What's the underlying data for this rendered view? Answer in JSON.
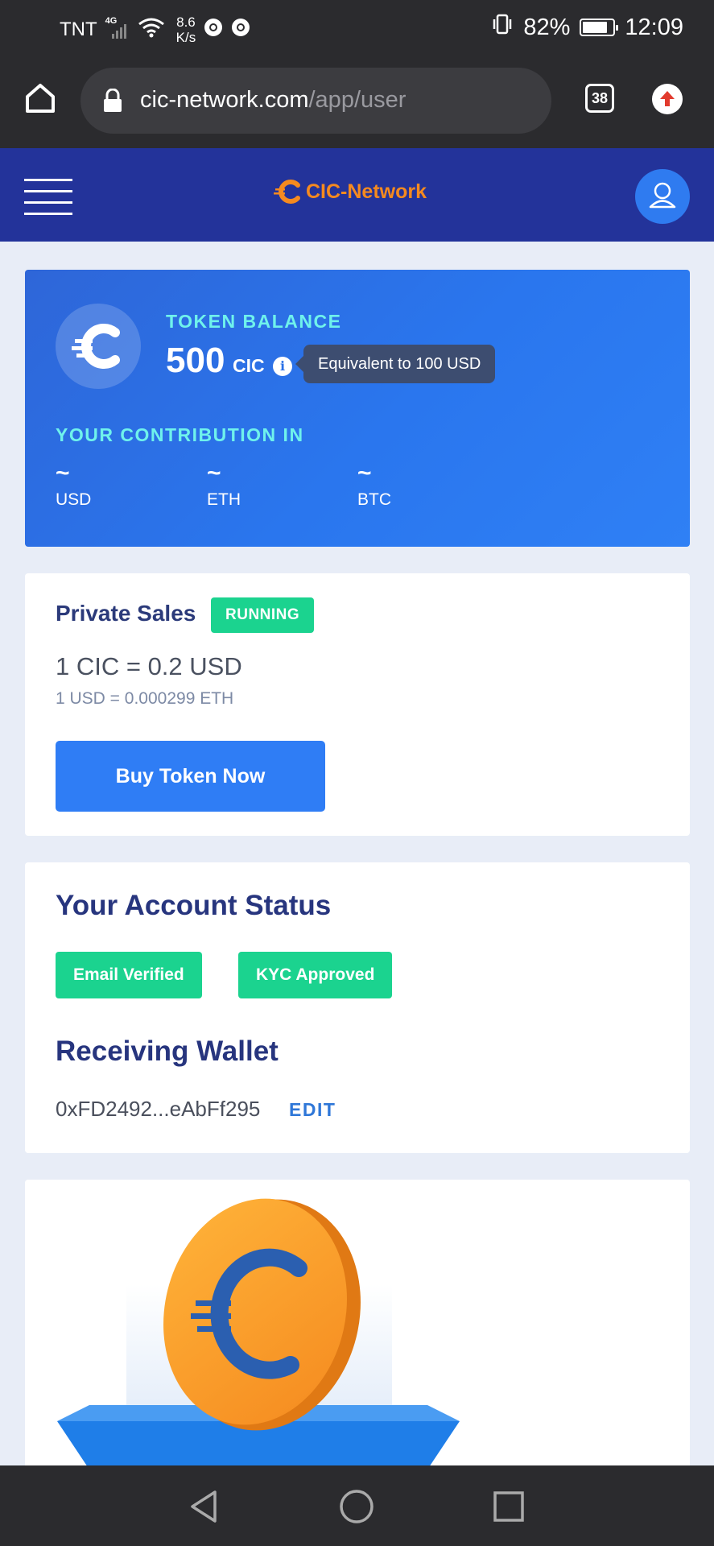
{
  "status_bar": {
    "carrier": "TNT",
    "network": "4G",
    "speed_value": "8.6",
    "speed_unit": "K/s",
    "battery": "82%",
    "battery_level": 0.82,
    "time": "12:09"
  },
  "browser": {
    "url_host": "cic-network.com",
    "url_path": "/app/user",
    "tab_count": "38"
  },
  "header": {
    "brand": "CIC-Network"
  },
  "token_card": {
    "label": "TOKEN BALANCE",
    "amount": "500",
    "unit": "CIC",
    "tooltip": "Equivalent to 100 USD",
    "contribution_label": "YOUR CONTRIBUTION IN",
    "contributions": [
      {
        "value": "~",
        "currency": "USD"
      },
      {
        "value": "~",
        "currency": "ETH"
      },
      {
        "value": "~",
        "currency": "BTC"
      }
    ]
  },
  "sales": {
    "title": "Private Sales",
    "badge": "RUNNING",
    "rate": "1 CIC = 0.2 USD",
    "rate_secondary": "1 USD = 0.000299 ETH",
    "button": "Buy Token Now"
  },
  "account": {
    "title": "Your Account Status",
    "badges": [
      "Email Verified",
      "KYC Approved"
    ],
    "wallet_title": "Receiving Wallet",
    "wallet_address": "0xFD2492...eAbFf295",
    "edit": "EDIT"
  },
  "colors": {
    "header_bg": "#23339a",
    "card_blue": "#2a76ee",
    "accent_cyan": "#6ff2ec",
    "success_green": "#1bd38f",
    "brand_orange": "#f58a1f",
    "button_blue": "#2f7df5"
  }
}
